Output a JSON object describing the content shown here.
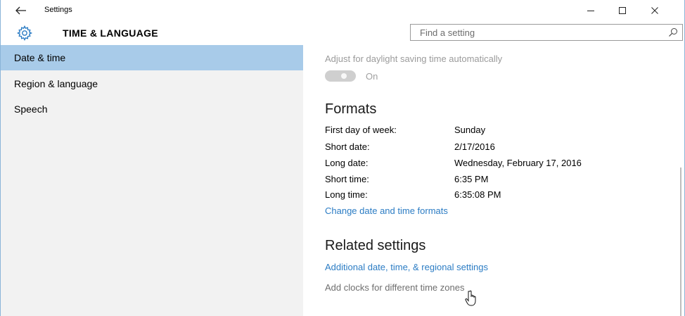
{
  "window": {
    "title": "Settings",
    "back_icon": "back-arrow-icon",
    "minimize_icon": "minimize-icon",
    "maximize_icon": "maximize-icon",
    "close_icon": "close-icon"
  },
  "header": {
    "icon": "gear-icon",
    "title": "TIME & LANGUAGE",
    "search": {
      "placeholder": "Find a setting",
      "icon": "search-icon"
    }
  },
  "sidebar": {
    "items": [
      {
        "label": "Date & time",
        "selected": true
      },
      {
        "label": "Region & language",
        "selected": false
      },
      {
        "label": "Speech",
        "selected": false
      }
    ]
  },
  "main": {
    "dst": {
      "label": "Adjust for daylight saving time automatically",
      "state": "On",
      "enabled": false
    },
    "formats": {
      "heading": "Formats",
      "rows": [
        {
          "label": "First day of week:",
          "value": "Sunday"
        },
        {
          "label": "Short date:",
          "value": "2/17/2016"
        },
        {
          "label": "Long date:",
          "value": "Wednesday, February 17, 2016"
        },
        {
          "label": "Short time:",
          "value": "6:35 PM"
        },
        {
          "label": "Long time:",
          "value": "6:35:08 PM"
        }
      ],
      "change_link": "Change date and time formats"
    },
    "related": {
      "heading": "Related settings",
      "links": [
        "Additional date, time, & regional settings",
        "Add clocks for different time zones"
      ]
    }
  },
  "colors": {
    "accent": "#2b7cc4",
    "selection": "#a8cbe9",
    "sidebar_bg": "#f2f2f2",
    "gear": "#2b7cc4"
  }
}
